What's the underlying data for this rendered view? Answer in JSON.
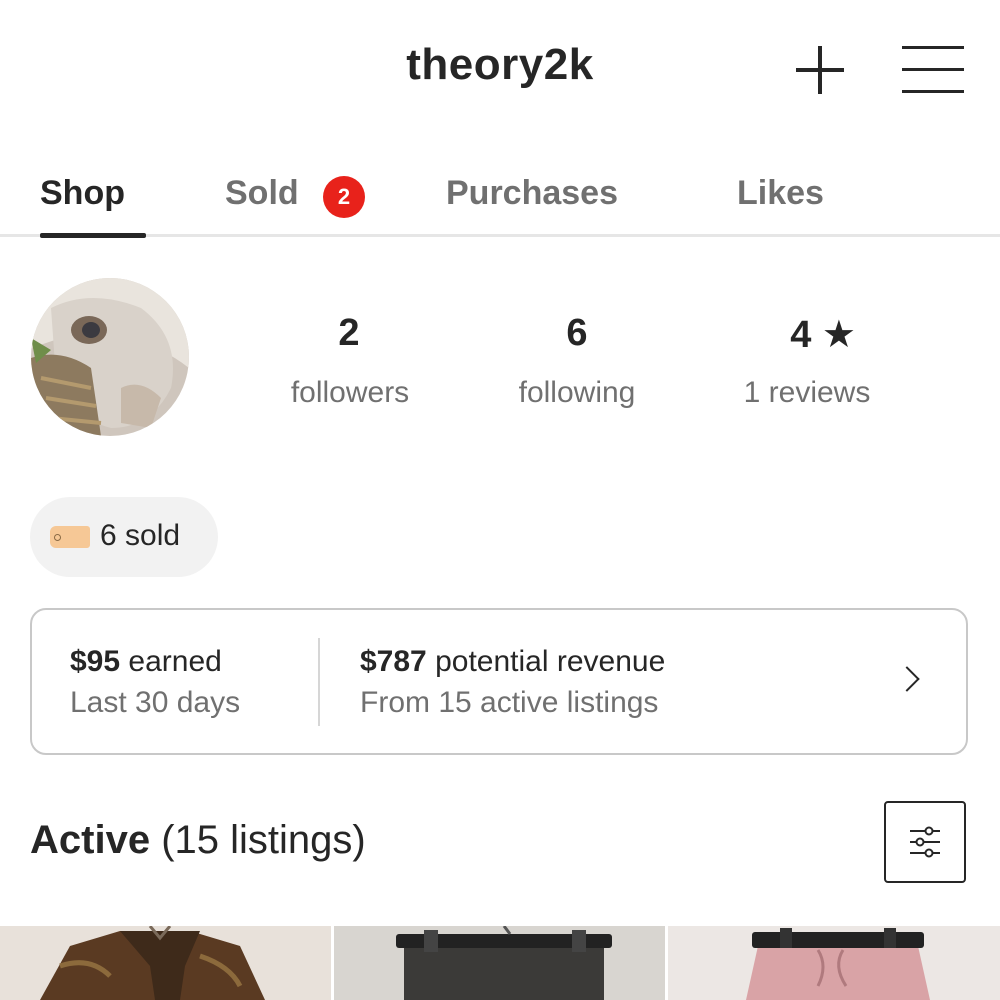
{
  "header": {
    "username": "theory2k",
    "add_icon": "plus-icon",
    "menu_icon": "hamburger-menu-icon"
  },
  "tabs": [
    {
      "label": "Shop",
      "active": true
    },
    {
      "label": "Sold",
      "active": false,
      "badge": "2"
    },
    {
      "label": "Purchases",
      "active": false
    },
    {
      "label": "Likes",
      "active": false
    }
  ],
  "profile": {
    "followers_count": "2",
    "followers_label": "followers",
    "following_count": "6",
    "following_label": "following",
    "rating": "4",
    "rating_icon": "star-icon",
    "reviews_label": "1 reviews"
  },
  "sold_chip": {
    "icon": "price-tag-icon",
    "label": "6 sold"
  },
  "revenue": {
    "earned_amount": "$95",
    "earned_label": "earned",
    "earned_period": "Last 30 days",
    "potential_amount": "$787",
    "potential_label": "potential revenue",
    "potential_source": "From 15 active listings"
  },
  "active_section": {
    "title": "Active",
    "count_text": "(15 listings)",
    "filter_icon": "filter-sliders-icon"
  },
  "colors": {
    "text_primary": "#262626",
    "text_secondary": "#707070",
    "badge_red": "#e8221b",
    "chip_bg": "#f2f2f2",
    "tag_orange": "#f6c896"
  }
}
